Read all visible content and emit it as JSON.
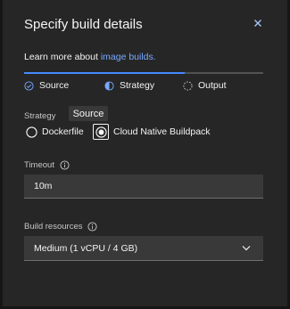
{
  "dialog": {
    "title": "Specify build details",
    "close_icon": "close-icon",
    "learn_more_prefix": "Learn more about ",
    "learn_more_link": "image builds."
  },
  "steps": [
    {
      "label": "Source",
      "state": "complete",
      "icon": "checkmark-circle-icon"
    },
    {
      "label": "Strategy",
      "state": "current",
      "icon": "half-circle-icon"
    },
    {
      "label": "Output",
      "state": "incomplete",
      "icon": "dashed-circle-icon"
    }
  ],
  "progress_fraction": 0.67,
  "strategy": {
    "label": "Strategy",
    "tooltip": "Source",
    "options": [
      {
        "label": "Dockerfile",
        "selected": false
      },
      {
        "label": "Cloud Native Buildpack",
        "selected": true
      }
    ]
  },
  "timeout": {
    "label": "Timeout",
    "value": "10m",
    "info_icon": "info-icon"
  },
  "build_resources": {
    "label": "Build resources",
    "value": "Medium (1 vCPU / 4 GB)",
    "info_icon": "info-icon",
    "chevron_icon": "chevron-down-icon"
  },
  "colors": {
    "background": "#161616",
    "panel": "#262626",
    "field": "#393939",
    "accent": "#4589ff",
    "link": "#78a9ff",
    "text": "#f4f4f4"
  }
}
